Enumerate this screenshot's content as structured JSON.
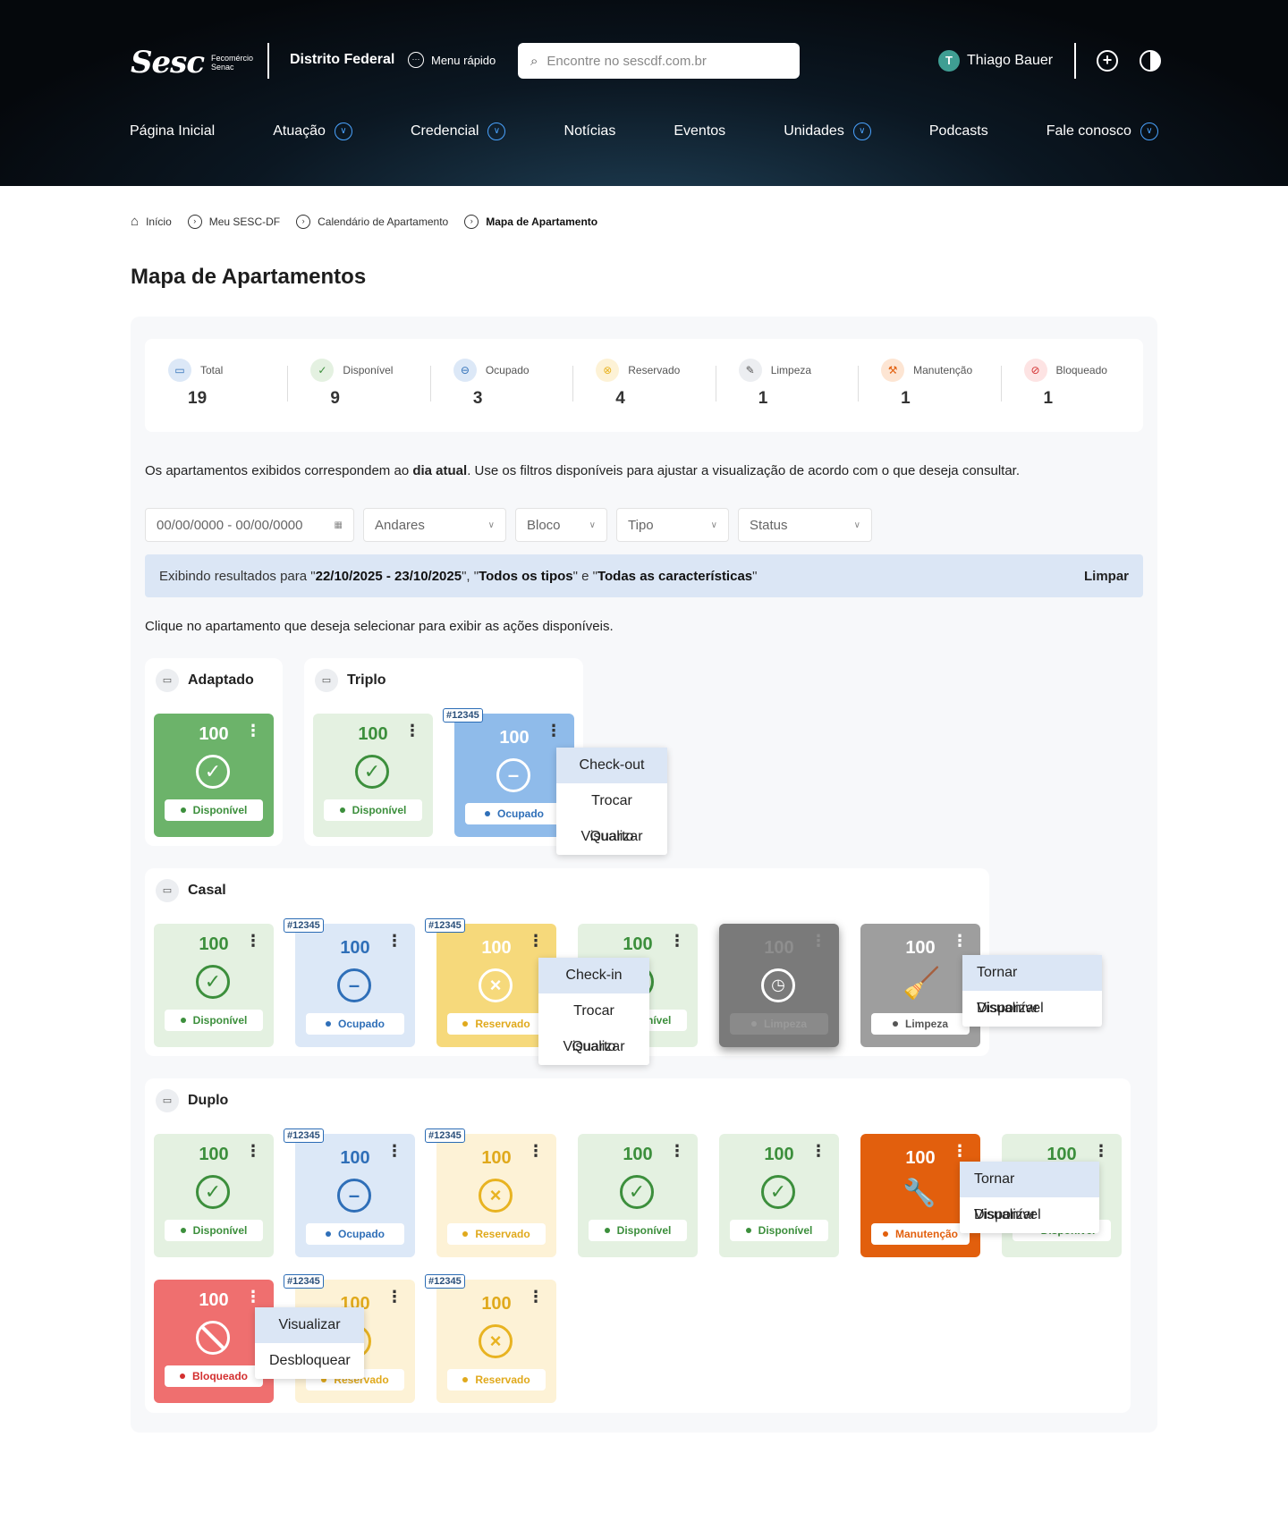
{
  "header": {
    "logo_text": "Sesc",
    "logo_sub1": "Fecomércio",
    "logo_sub2": "Senac",
    "region": "Distrito Federal",
    "quick_menu": "Menu rápido",
    "search_placeholder": "Encontre no sescdf.com.br",
    "user_initial": "T",
    "user_name": "Thiago Bauer",
    "nav": [
      "Página Inicial",
      "Atuação",
      "Credencial",
      "Notícias",
      "Eventos",
      "Unidades",
      "Podcasts",
      "Fale conosco"
    ]
  },
  "breadcrumb": [
    "Início",
    "Meu SESC-DF",
    "Calendário de Apartamento",
    "Mapa de Apartamento"
  ],
  "page_title": "Mapa de Apartamentos",
  "stats": [
    {
      "label": "Total",
      "value": "19"
    },
    {
      "label": "Disponível",
      "value": "9"
    },
    {
      "label": "Ocupado",
      "value": "3"
    },
    {
      "label": "Reservado",
      "value": "4"
    },
    {
      "label": "Limpeza",
      "value": "1"
    },
    {
      "label": "Manutenção",
      "value": "1"
    },
    {
      "label": "Bloqueado",
      "value": "1"
    }
  ],
  "info": {
    "before": "Os apartamentos exibidos correspondem ao ",
    "bold": "dia atual",
    "after": ". Use os filtros disponíveis para ajustar a visualização de acordo com o que deseja consultar."
  },
  "filters": {
    "date": "00/00/0000 - 00/00/0000",
    "floors": "Andares",
    "block": "Bloco",
    "type": "Tipo",
    "status": "Status"
  },
  "results": {
    "prefix": "Exibindo resultados para \"",
    "range": "22/10/2025 - 23/10/2025",
    "mid1": "\", \"",
    "types": "Todos os tipos",
    "mid2": "\" e \"",
    "features": "Todas as características",
    "suffix": "\"",
    "clear": "Limpar"
  },
  "hint": "Clique no apartamento que deseja selecionar para exibir as ações disponíveis.",
  "groups": {
    "adaptado": "Adaptado",
    "triplo": "Triplo",
    "casal": "Casal",
    "duplo": "Duplo"
  },
  "room": {
    "number": "100",
    "tag": "#12345",
    "disponivel": "Disponível",
    "ocupado": "Ocupado",
    "reservado": "Reservado",
    "limpeza": "Limpeza",
    "manutencao": "Manutenção",
    "bloqueado": "Bloqueado"
  },
  "menus": {
    "checkout": "Check-out",
    "checkin": "Check-in",
    "trocar": "Trocar Quarto",
    "visualizar": "Visualizar",
    "tornar": "Tornar Disponível",
    "desbloquear": "Desbloquear"
  },
  "colors": {
    "disponivel": "#3c8f3c",
    "ocupado": "#2f6fb8",
    "reservado": "#e8b321",
    "limpeza": "#9e9e9e",
    "manutencao": "#e25f0d",
    "bloqueado": "#ef6f6f"
  }
}
